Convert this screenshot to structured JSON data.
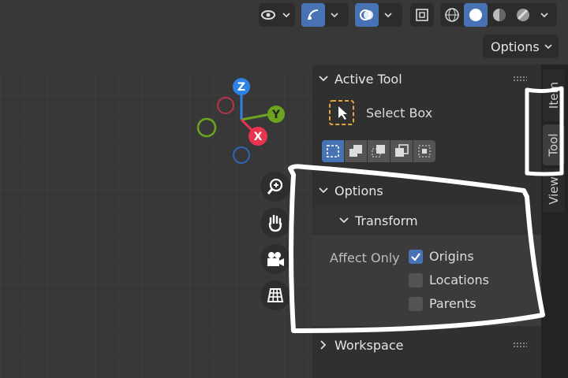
{
  "header": {
    "options_label": "Options",
    "icons": [
      "visibility-eye-icon",
      "gizmo-icon",
      "overlay-icon",
      "xray-toggle-icon",
      "wireframe-shading-icon",
      "solid-shading-icon",
      "material-shading-icon",
      "rendered-shading-icon"
    ]
  },
  "gizmo": {
    "axis_z": "Z",
    "axis_y": "Y",
    "axis_x": "X"
  },
  "nav_buttons": [
    "zoom-icon",
    "pan-hand-icon",
    "camera-icon",
    "ortho-grid-icon"
  ],
  "panel": {
    "active_tool": {
      "title": "Active Tool",
      "tool_name": "Select Box",
      "modes": [
        "mode-set-icon",
        "mode-extend-icon",
        "mode-subtract-icon",
        "mode-difference-icon",
        "mode-intersect-icon"
      ]
    },
    "options": {
      "title": "Options",
      "transform": {
        "title": "Transform",
        "affect_label": "Affect Only",
        "items": [
          {
            "label": "Origins",
            "checked": true
          },
          {
            "label": "Locations",
            "checked": false
          },
          {
            "label": "Parents",
            "checked": false
          }
        ]
      }
    },
    "workspace": {
      "title": "Workspace"
    }
  },
  "tabs": [
    "Item",
    "Tool",
    "View"
  ],
  "colors": {
    "accent": "#4772b3",
    "axis_x": "#e8344e",
    "axis_y": "#6ba51f",
    "axis_z": "#2e82e6",
    "select_box_dash": "#e8a33d"
  }
}
